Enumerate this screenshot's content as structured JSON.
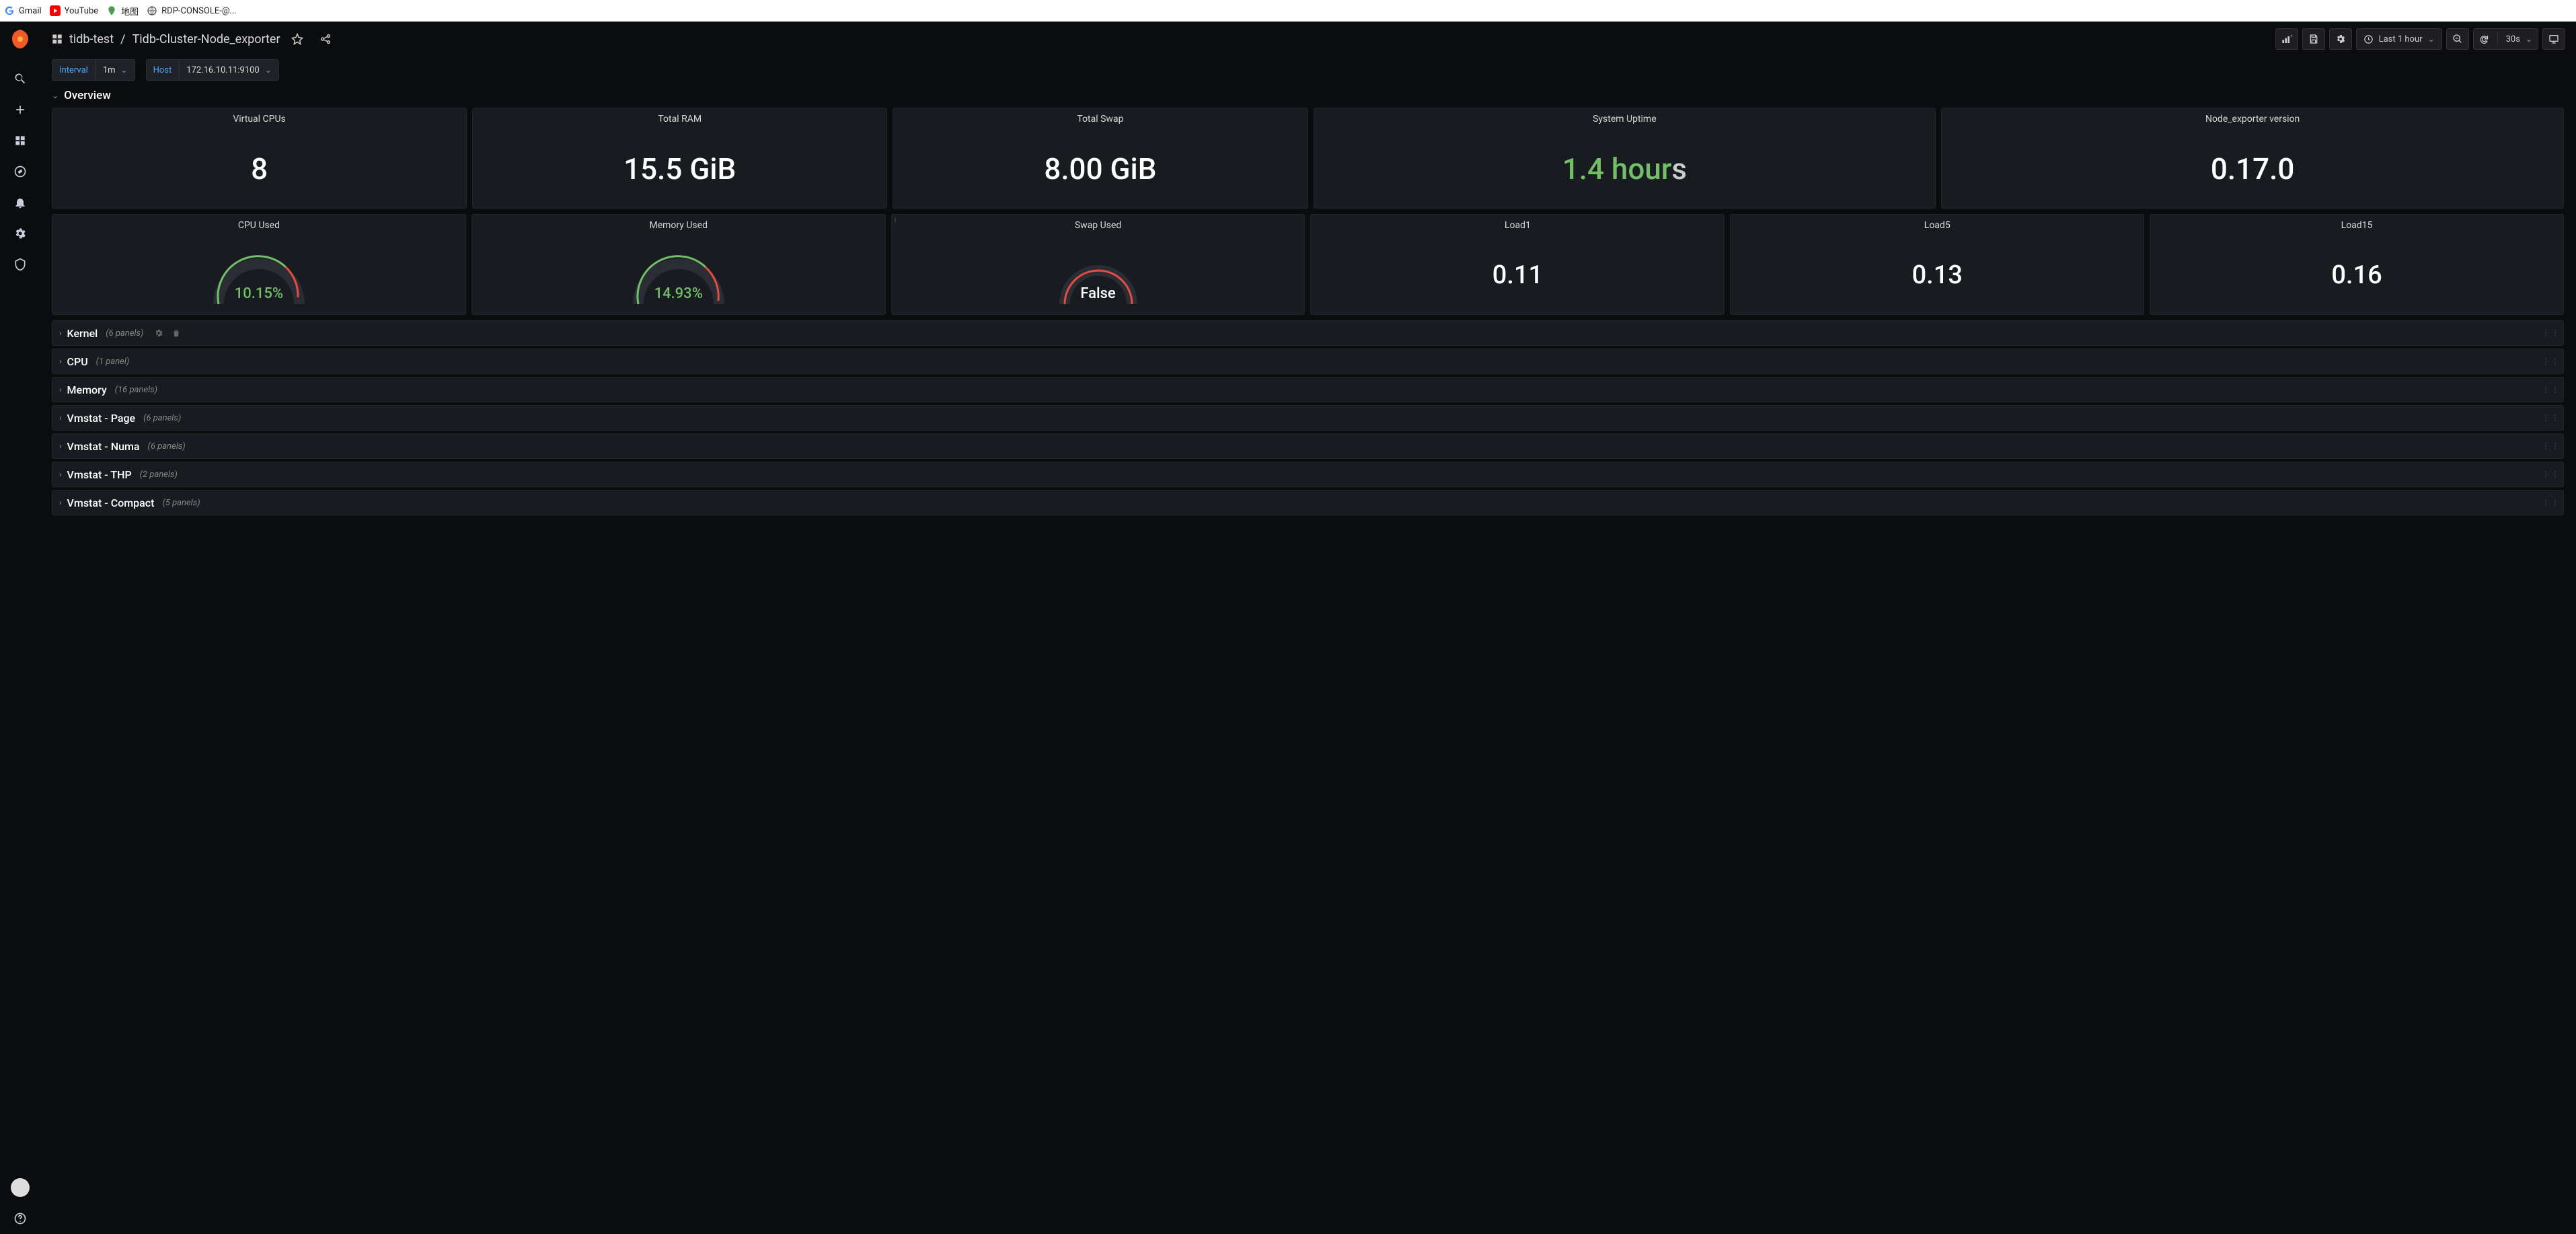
{
  "bookmarks": {
    "gmail": "Gmail",
    "youtube": "YouTube",
    "maps": "地图",
    "rdp": "RDP-CONSOLE-@..."
  },
  "breadcrumb": {
    "folder": "tidb-test",
    "sep": "/",
    "dashboard": "Tidb-Cluster-Node_exporter"
  },
  "toolbar": {
    "time": "Last 1 hour",
    "refresh": "30s"
  },
  "vars": {
    "interval_label": "Interval",
    "interval_value": "1m",
    "host_label": "Host",
    "host_value": "172.16.10.11:9100"
  },
  "section_overview": "Overview",
  "chart_data": [
    {
      "type": "table",
      "title": "Virtual CPUs",
      "values": [
        8
      ]
    },
    {
      "type": "table",
      "title": "Total RAM",
      "values": [
        "15.5 GiB"
      ]
    },
    {
      "type": "table",
      "title": "Total Swap",
      "values": [
        "8.00 GiB"
      ]
    },
    {
      "type": "table",
      "title": "System Uptime",
      "values": [
        "1.4 hours"
      ]
    },
    {
      "type": "table",
      "title": "Node_exporter version",
      "values": [
        "0.17.0"
      ]
    },
    {
      "type": "bar",
      "title": "CPU Used",
      "values": [
        10.15
      ],
      "ylim": [
        0,
        100
      ]
    },
    {
      "type": "bar",
      "title": "Memory Used",
      "values": [
        14.93
      ],
      "ylim": [
        0,
        100
      ]
    },
    {
      "type": "bar",
      "title": "Swap Used",
      "values": [
        "False"
      ],
      "ylim": [
        0,
        100
      ]
    },
    {
      "type": "table",
      "title": "Load1",
      "values": [
        0.11
      ]
    },
    {
      "type": "table",
      "title": "Load5",
      "values": [
        0.13
      ]
    },
    {
      "type": "table",
      "title": "Load15",
      "values": [
        0.16
      ]
    }
  ],
  "panels": {
    "vcpu": {
      "title": "Virtual CPUs",
      "value": "8"
    },
    "ram": {
      "title": "Total RAM",
      "value": "15.5 GiB"
    },
    "swap": {
      "title": "Total Swap",
      "value": "8.00 GiB"
    },
    "uptime": {
      "title": "System Uptime",
      "value": "1.4 hour",
      "unit": "s"
    },
    "nev": {
      "title": "Node_exporter version",
      "value": "0.17.0"
    },
    "cpuused": {
      "title": "CPU Used",
      "value": "10.15%"
    },
    "memused": {
      "title": "Memory Used",
      "value": "14.93%"
    },
    "swapused": {
      "title": "Swap Used",
      "value": "False"
    },
    "load1": {
      "title": "Load1",
      "value": "0.11"
    },
    "load5": {
      "title": "Load5",
      "value": "0.13"
    },
    "load15": {
      "title": "Load15",
      "value": "0.16"
    }
  },
  "rows": [
    {
      "name": "Kernel",
      "count": "(6 panels)"
    },
    {
      "name": "CPU",
      "count": "(1 panel)"
    },
    {
      "name": "Memory",
      "count": "(16 panels)"
    },
    {
      "name": "Vmstat - Page",
      "count": "(6 panels)"
    },
    {
      "name": "Vmstat - Numa",
      "count": "(6 panels)"
    },
    {
      "name": "Vmstat - THP",
      "count": "(2 panels)"
    },
    {
      "name": "Vmstat - Compact",
      "count": "(5 panels)"
    }
  ]
}
